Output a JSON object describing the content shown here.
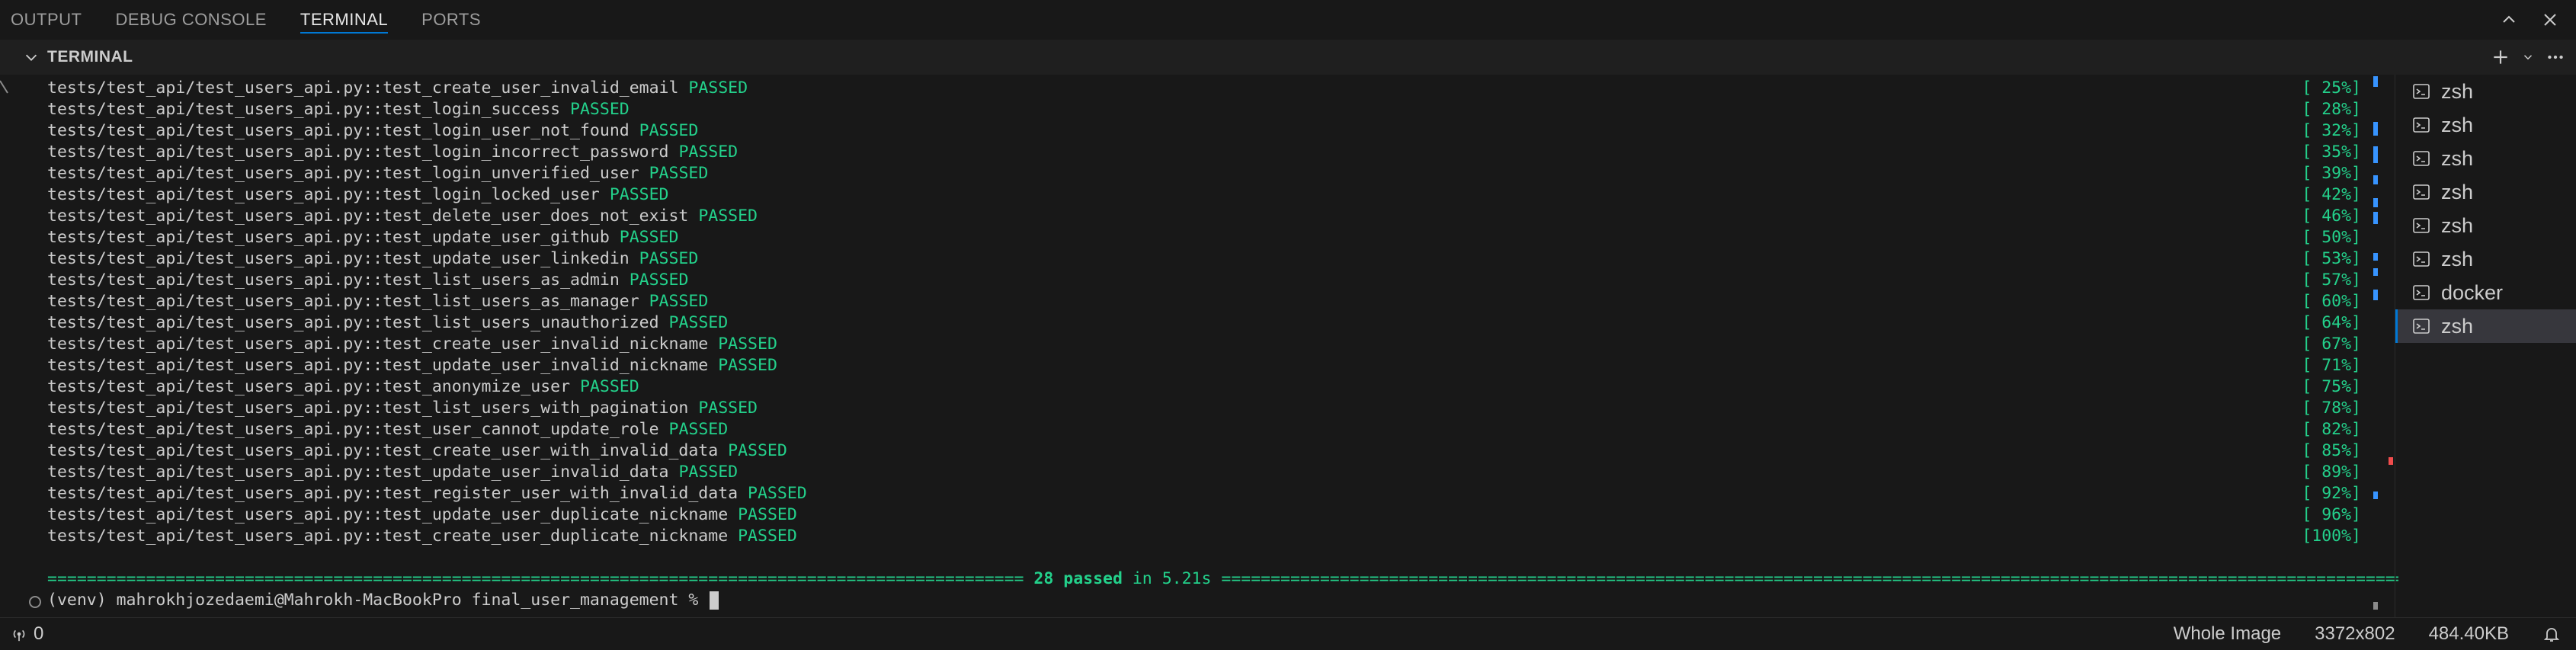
{
  "panel_tabs": [
    "OUTPUT",
    "DEBUG CONSOLE",
    "TERMINAL",
    "PORTS"
  ],
  "active_tab": "TERMINAL",
  "section": {
    "title": "TERMINAL"
  },
  "terminal": {
    "lines": [
      {
        "prefix": "tests/test_api/test_users_api.py::test_create_user_invalid_email",
        "status": "PASSED",
        "percent": "[ 25%]"
      },
      {
        "prefix": "tests/test_api/test_users_api.py::test_login_success",
        "status": "PASSED",
        "percent": "[ 28%]"
      },
      {
        "prefix": "tests/test_api/test_users_api.py::test_login_user_not_found",
        "status": "PASSED",
        "percent": "[ 32%]"
      },
      {
        "prefix": "tests/test_api/test_users_api.py::test_login_incorrect_password",
        "status": "PASSED",
        "percent": "[ 35%]"
      },
      {
        "prefix": "tests/test_api/test_users_api.py::test_login_unverified_user",
        "status": "PASSED",
        "percent": "[ 39%]"
      },
      {
        "prefix": "tests/test_api/test_users_api.py::test_login_locked_user",
        "status": "PASSED",
        "percent": "[ 42%]"
      },
      {
        "prefix": "tests/test_api/test_users_api.py::test_delete_user_does_not_exist",
        "status": "PASSED",
        "percent": "[ 46%]"
      },
      {
        "prefix": "tests/test_api/test_users_api.py::test_update_user_github",
        "status": "PASSED",
        "percent": "[ 50%]"
      },
      {
        "prefix": "tests/test_api/test_users_api.py::test_update_user_linkedin",
        "status": "PASSED",
        "percent": "[ 53%]"
      },
      {
        "prefix": "tests/test_api/test_users_api.py::test_list_users_as_admin",
        "status": "PASSED",
        "percent": "[ 57%]"
      },
      {
        "prefix": "tests/test_api/test_users_api.py::test_list_users_as_manager",
        "status": "PASSED",
        "percent": "[ 60%]"
      },
      {
        "prefix": "tests/test_api/test_users_api.py::test_list_users_unauthorized",
        "status": "PASSED",
        "percent": "[ 64%]"
      },
      {
        "prefix": "tests/test_api/test_users_api.py::test_create_user_invalid_nickname",
        "status": "PASSED",
        "percent": "[ 67%]"
      },
      {
        "prefix": "tests/test_api/test_users_api.py::test_update_user_invalid_nickname",
        "status": "PASSED",
        "percent": "[ 71%]"
      },
      {
        "prefix": "tests/test_api/test_users_api.py::test_anonymize_user",
        "status": "PASSED",
        "percent": "[ 75%]"
      },
      {
        "prefix": "tests/test_api/test_users_api.py::test_list_users_with_pagination",
        "status": "PASSED",
        "percent": "[ 78%]"
      },
      {
        "prefix": "tests/test_api/test_users_api.py::test_user_cannot_update_role",
        "status": "PASSED",
        "percent": "[ 82%]"
      },
      {
        "prefix": "tests/test_api/test_users_api.py::test_create_user_with_invalid_data",
        "status": "PASSED",
        "percent": "[ 85%]"
      },
      {
        "prefix": "tests/test_api/test_users_api.py::test_update_user_invalid_data",
        "status": "PASSED",
        "percent": "[ 89%]"
      },
      {
        "prefix": "tests/test_api/test_users_api.py::test_register_user_with_invalid_data",
        "status": "PASSED",
        "percent": "[ 92%]"
      },
      {
        "prefix": "tests/test_api/test_users_api.py::test_update_user_duplicate_nickname",
        "status": "PASSED",
        "percent": "[ 96%]"
      },
      {
        "prefix": "tests/test_api/test_users_api.py::test_create_user_duplicate_nickname",
        "status": "PASSED",
        "percent": "[100%]"
      }
    ],
    "summary_passed": "28 passed",
    "summary_time": " in 5.21s ",
    "prompt": "(venv) mahrokhjozedaemi@Mahrokh-MacBookPro final_user_management % "
  },
  "terminal_list": [
    {
      "label": "zsh",
      "active": false
    },
    {
      "label": "zsh",
      "active": false
    },
    {
      "label": "zsh",
      "active": false
    },
    {
      "label": "zsh",
      "active": false
    },
    {
      "label": "zsh",
      "active": false
    },
    {
      "label": "zsh",
      "active": false
    },
    {
      "label": "docker",
      "active": false
    },
    {
      "label": "zsh",
      "active": true
    }
  ],
  "statusbar": {
    "ports_count": "0",
    "image_mode": "Whole Image",
    "dimensions": "3372x802",
    "file_size": "484.40KB"
  },
  "colors": {
    "passed": "#23d18b",
    "accent": "#0078d4",
    "background": "#181818"
  }
}
